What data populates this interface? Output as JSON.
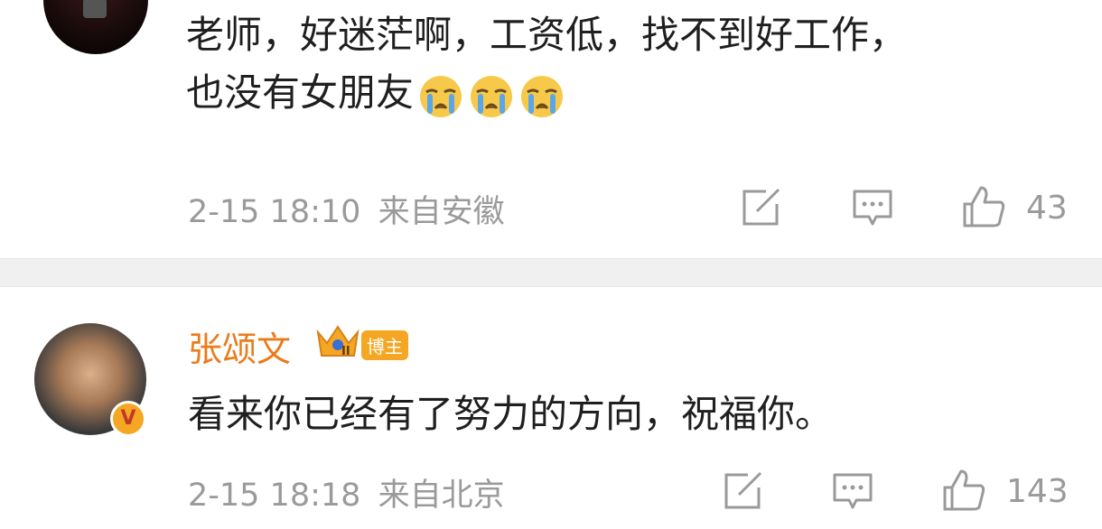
{
  "comment1": {
    "text_line1": "老师，好迷茫啊，工资低，找不到好工作，",
    "text_line2": "也没有女朋友",
    "emojis": [
      "crying-face-emoji",
      "crying-face-emoji",
      "crying-face-emoji"
    ],
    "timestamp": "2-15 18:10",
    "location": "来自安徽",
    "like_count": "43"
  },
  "comment2": {
    "username": "张颂文",
    "badge_label": "博主",
    "badge_level": "II",
    "verified_mark": "V",
    "text": "看来你已经有了努力的方向，祝福你。",
    "timestamp": "2-15 18:18",
    "location": "来自北京",
    "like_count": "143"
  },
  "colors": {
    "username": "#eb7b1b",
    "meta_text": "#9a9a9a",
    "divider": "#f0f0f0"
  }
}
